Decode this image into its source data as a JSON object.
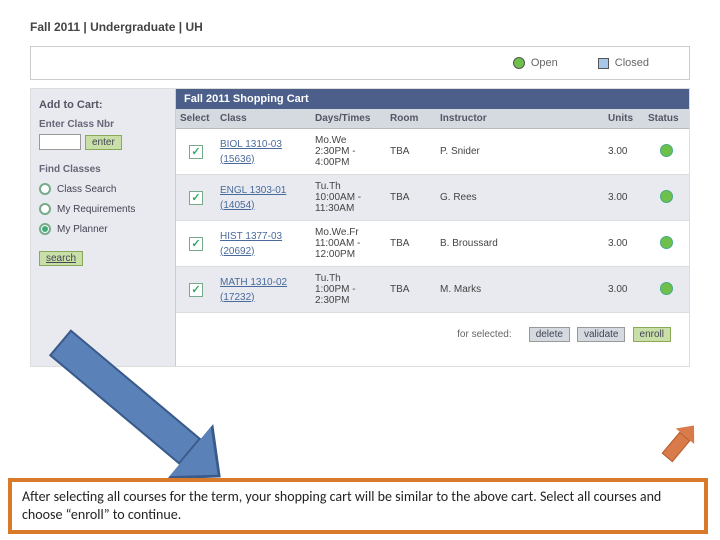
{
  "breadcrumb": "Fall 2011 | Undergraduate | UH",
  "legend": {
    "open": "Open",
    "closed": "Closed"
  },
  "sidebar": {
    "add_label": "Add to Cart:",
    "enter_label": "Enter Class Nbr",
    "enter_btn": "enter",
    "find_label": "Find Classes",
    "radios": [
      {
        "label": "Class Search",
        "checked": false
      },
      {
        "label": "My Requirements",
        "checked": false
      },
      {
        "label": "My Planner",
        "checked": true
      }
    ],
    "search_btn": "search"
  },
  "cart": {
    "title": "Fall 2011 Shopping Cart",
    "cols": {
      "select": "Select",
      "class": "Class",
      "days": "Days/Times",
      "room": "Room",
      "instructor": "Instructor",
      "units": "Units",
      "status": "Status"
    },
    "rows": [
      {
        "class_code": "BIOL 1310-03",
        "class_nbr": "(15636)",
        "days": "Mo.We\n2:30PM -\n4:00PM",
        "room": "TBA",
        "instructor": "P. Snider",
        "units": "3.00"
      },
      {
        "class_code": "ENGL 1303-01",
        "class_nbr": "(14054)",
        "days": "Tu.Th\n10:00AM -\n11:30AM",
        "room": "TBA",
        "instructor": "G. Rees",
        "units": "3.00"
      },
      {
        "class_code": "HIST 1377-03",
        "class_nbr": "(20692)",
        "days": "Mo.We.Fr\n11:00AM -\n12:00PM",
        "room": "TBA",
        "instructor": "B. Broussard",
        "units": "3.00"
      },
      {
        "class_code": "MATH 1310-02",
        "class_nbr": "(17232)",
        "days": "Tu.Th\n1:00PM -\n2:30PM",
        "room": "TBA",
        "instructor": "M. Marks",
        "units": "3.00"
      }
    ]
  },
  "actions": {
    "label": "for selected:",
    "delete": "delete",
    "validate": "validate",
    "enroll": "enroll"
  },
  "note": "After selecting all courses for the term,  your shopping cart will be similar to the above cart.  Select all courses and choose “enroll” to continue."
}
